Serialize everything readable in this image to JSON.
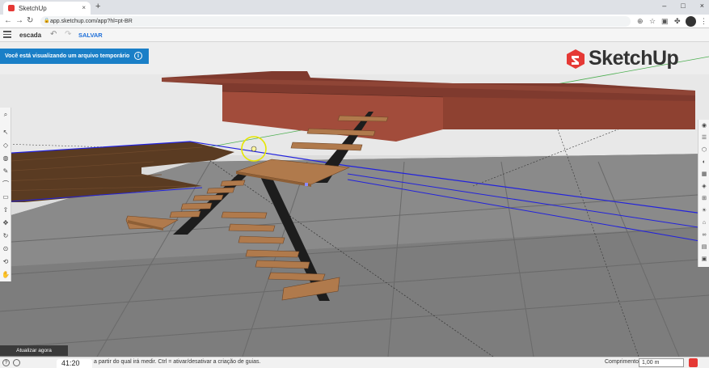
{
  "browser": {
    "tab_title": "SketchUp",
    "tab_close": "×",
    "new_tab": "+",
    "url": "app.sketchup.com/app?hl=pt-BR",
    "nav": {
      "back": "←",
      "forward": "→",
      "reload": "↻"
    },
    "window_controls": {
      "minimize": "–",
      "maximize": "□",
      "close": "×"
    }
  },
  "toolbar": {
    "file_name": "escada",
    "undo_glyph": "↶",
    "redo_glyph": "↷",
    "save_label": "SALVAR"
  },
  "banner": {
    "text": "Você está visualizando um arquivo temporário",
    "info_glyph": "i"
  },
  "logo": {
    "text": "SketchUp"
  },
  "update_button": "Atualizar agora",
  "status": {
    "time": "41:20",
    "help_glyph": "?",
    "hint": "a partir do qual irá medir. Ctrl = ativar/desativar a criação de guias.",
    "measure_label": "Comprimento",
    "measure_value": "1,00 m"
  },
  "colors": {
    "accent": "#1a7fc7",
    "sketchup_red": "#e53935",
    "slab": "#9e4a3c",
    "tread": "#b07a4c"
  }
}
